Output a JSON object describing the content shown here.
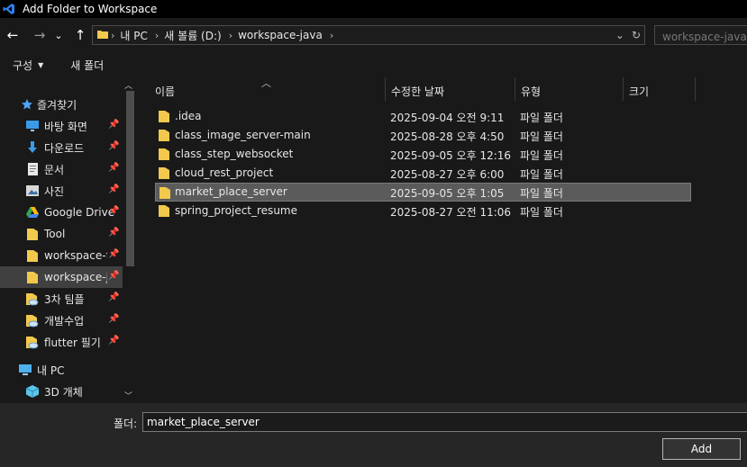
{
  "window": {
    "title": "Add Folder to Workspace"
  },
  "nav": {
    "back": "←",
    "forward": "→",
    "recent": "⌄",
    "up": "↑"
  },
  "address": {
    "crumbs": [
      "내 PC",
      "새 볼륨 (D:)",
      "workspace-java"
    ],
    "refresh": "↻",
    "dropdown": "⌄"
  },
  "search": {
    "placeholder": "workspace-java 검색"
  },
  "toolbar": {
    "organize": "구성",
    "new_folder": "새 폴더"
  },
  "sidebar": {
    "items": [
      {
        "label": "즐겨찾기",
        "icon": "star-icon"
      },
      {
        "label": "바탕 화면",
        "icon": "desktop-icon",
        "pinned": true
      },
      {
        "label": "다운로드",
        "icon": "download-icon",
        "pinned": true
      },
      {
        "label": "문서",
        "icon": "document-icon",
        "pinned": true
      },
      {
        "label": "사진",
        "icon": "picture-icon",
        "pinned": true
      },
      {
        "label": "Google Drive",
        "icon": "google-drive-icon",
        "pinned": true
      },
      {
        "label": "Tool",
        "icon": "folder-icon",
        "pinned": true
      },
      {
        "label": "workspace-flutter",
        "icon": "folder-icon",
        "pinned": true
      },
      {
        "label": "workspace-java",
        "icon": "folder-icon",
        "pinned": true,
        "selected": true
      },
      {
        "label": "3차 팀플",
        "icon": "cloud-folder-icon",
        "pinned": true
      },
      {
        "label": "개발수업",
        "icon": "cloud-folder-icon",
        "pinned": true
      },
      {
        "label": "flutter 필기",
        "icon": "cloud-folder-icon",
        "pinned": true
      },
      {
        "label": "내 PC",
        "icon": "pc-icon"
      },
      {
        "label": "3D 개체",
        "icon": "3d-objects-icon"
      }
    ]
  },
  "columns": {
    "name": "이름",
    "modified": "수정한 날짜",
    "type": "유형",
    "size": "크기"
  },
  "files": [
    {
      "name": ".idea",
      "modified": "2025-09-04 오전 9:11",
      "type": "파일 폴더"
    },
    {
      "name": "class_image_server-main",
      "modified": "2025-08-28 오후 4:50",
      "type": "파일 폴더"
    },
    {
      "name": "class_step_websocket",
      "modified": "2025-09-05 오후 12:16",
      "type": "파일 폴더"
    },
    {
      "name": "cloud_rest_project",
      "modified": "2025-08-27 오후 6:00",
      "type": "파일 폴더"
    },
    {
      "name": "market_place_server",
      "modified": "2025-09-05 오후 1:05",
      "type": "파일 폴더",
      "selected": true
    },
    {
      "name": "spring_project_resume",
      "modified": "2025-08-27 오전 11:06",
      "type": "파일 폴더"
    }
  ],
  "footer": {
    "folder_label": "폴더:",
    "folder_value": "market_place_server",
    "add_label": "Add"
  },
  "colors": {
    "folder": "#f2c94c",
    "vscode": "#2f80ed",
    "selection": "#5b5b5b"
  }
}
